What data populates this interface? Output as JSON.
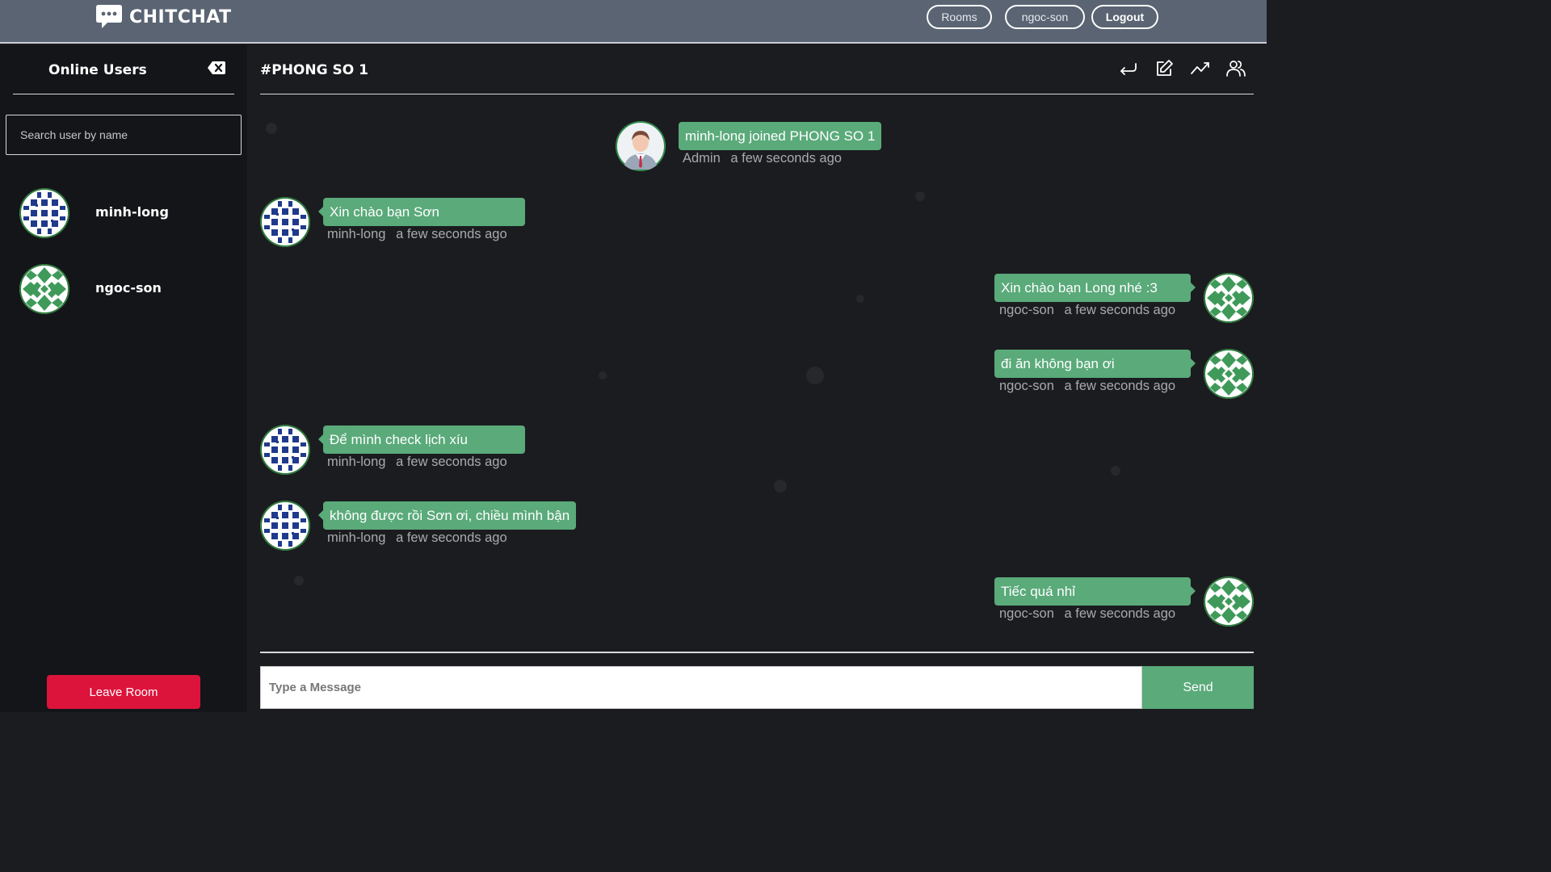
{
  "header": {
    "brand": "CHITCHAT",
    "nav": {
      "rooms": "Rooms",
      "user": "ngoc-son",
      "logout": "Logout"
    }
  },
  "sidebar": {
    "title": "Online Users",
    "search_placeholder": "Search user by name",
    "users": [
      {
        "name": "minh-long",
        "avatar": "blue-pattern-avatar"
      },
      {
        "name": "ngoc-son",
        "avatar": "green-pattern-avatar"
      }
    ],
    "leave_label": "Leave Room"
  },
  "room": {
    "title": "#PHONG SO 1",
    "header_icons": [
      "return-icon",
      "edit-icon",
      "chart-icon",
      "users-icon"
    ]
  },
  "messages": [
    {
      "author": "Admin",
      "time": "a few seconds ago",
      "text": "minh-long joined PHONG SO 1",
      "side": "center"
    },
    {
      "author": "minh-long",
      "time": "a few seconds ago",
      "text": "Xin chào bạn Sơn",
      "side": "left"
    },
    {
      "author": "ngoc-son",
      "time": "a few seconds ago",
      "text": "Xin chào bạn Long nhé :3",
      "side": "right"
    },
    {
      "author": "ngoc-son",
      "time": "a few seconds ago",
      "text": "đi ăn không bạn ơi",
      "side": "right"
    },
    {
      "author": "minh-long",
      "time": "a few seconds ago",
      "text": "Để mình check lịch xíu",
      "side": "left"
    },
    {
      "author": "minh-long",
      "time": "a few seconds ago",
      "text": "không được rồi Sơn ơi, chiều mình bận",
      "side": "left"
    },
    {
      "author": "ngoc-son",
      "time": "a few seconds ago",
      "text": "Tiếc quá nhỉ",
      "side": "right"
    }
  ],
  "composer": {
    "placeholder": "Type a Message",
    "send_label": "Send"
  },
  "colors": {
    "topbar": "#5a6473",
    "bubble": "#5aaa7a",
    "leave": "#dc143c",
    "background": "#1b1c1f",
    "sidebar": "#141519"
  }
}
